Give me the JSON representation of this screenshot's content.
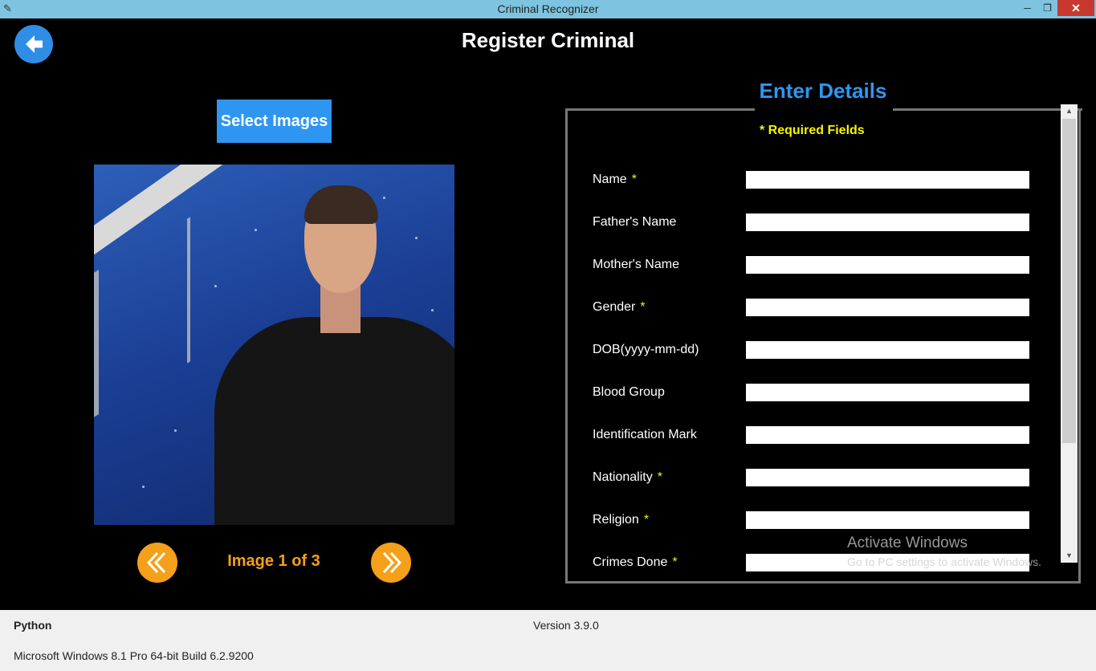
{
  "window": {
    "title": "Criminal Recognizer",
    "minimize": "─",
    "maximize": "❐",
    "close": "✕"
  },
  "page": {
    "title": "Register Criminal"
  },
  "left": {
    "select_images": "Select Images",
    "image_counter": "Image 1 of 3"
  },
  "form": {
    "legend": "Enter Details",
    "required_note": "* Required Fields",
    "fields": [
      {
        "label": "Name",
        "required": "*",
        "value": ""
      },
      {
        "label": "Father's Name",
        "required": "",
        "value": ""
      },
      {
        "label": "Mother's Name",
        "required": "",
        "value": ""
      },
      {
        "label": "Gender",
        "required": "*",
        "value": ""
      },
      {
        "label": "DOB(yyyy-mm-dd)",
        "required": "",
        "value": ""
      },
      {
        "label": "Blood Group",
        "required": "",
        "value": ""
      },
      {
        "label": "Identification Mark",
        "required": "",
        "value": ""
      },
      {
        "label": "Nationality",
        "required": "*",
        "value": ""
      },
      {
        "label": "Religion",
        "required": "*",
        "value": ""
      },
      {
        "label": "Crimes Done",
        "required": "*",
        "value": ""
      }
    ]
  },
  "watermark": {
    "line1": "Activate Windows",
    "line2": "Go to PC settings to activate Windows."
  },
  "statusbar": {
    "python": "Python",
    "version": "Version 3.9.0",
    "os": "Microsoft Windows 8.1 Pro 64-bit Build 6.2.9200"
  },
  "icons": {
    "back": "arrow-left-icon",
    "prev": "double-chevron-left-icon",
    "next": "double-chevron-right-icon",
    "app": "feather-icon"
  },
  "colors": {
    "accent_blue": "#2e96f0",
    "accent_orange": "#f5a01a",
    "required_yellow": "#f5f500",
    "titlebar": "#7ec4e0"
  }
}
